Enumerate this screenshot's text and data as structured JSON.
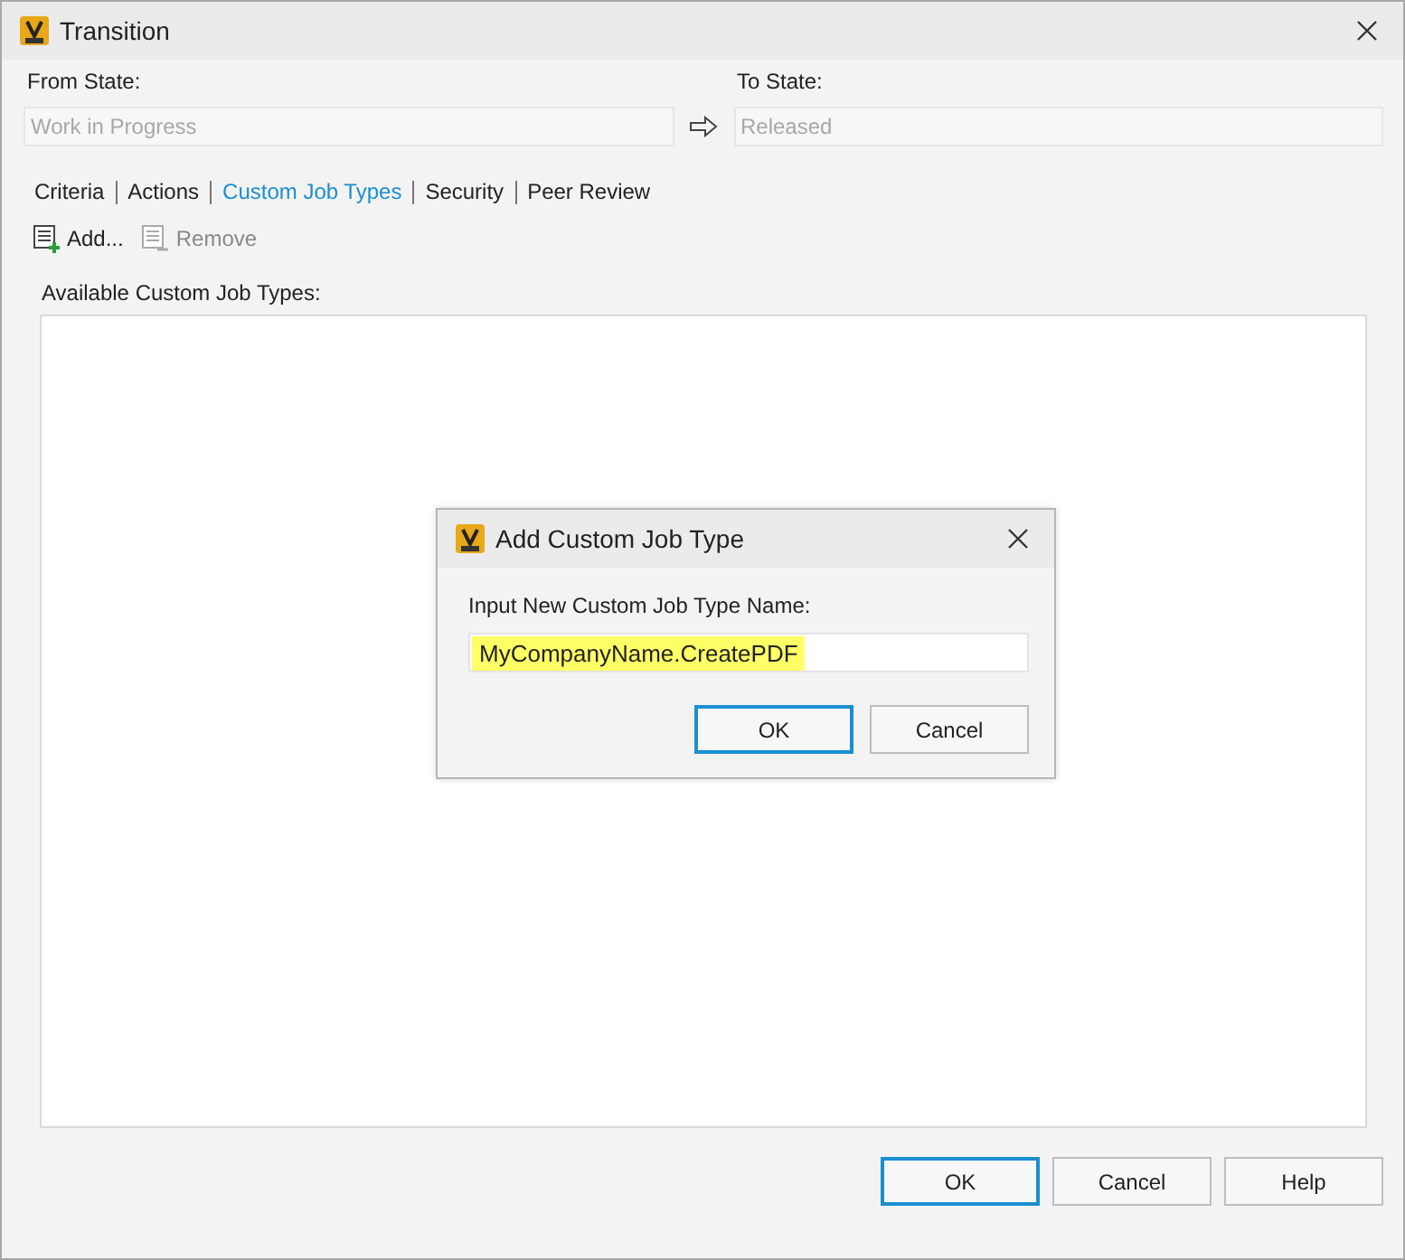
{
  "window": {
    "title": "Transition"
  },
  "from_state": {
    "label": "From State:",
    "value": "Work in Progress",
    "disabled": true
  },
  "to_state": {
    "label": "To State:",
    "value": "Released",
    "disabled": true
  },
  "tabs": [
    {
      "label": "Criteria",
      "selected": false
    },
    {
      "label": "Actions",
      "selected": false
    },
    {
      "label": "Custom Job Types",
      "selected": true
    },
    {
      "label": "Security",
      "selected": false
    },
    {
      "label": "Peer Review",
      "selected": false
    }
  ],
  "toolbar": [
    {
      "kind": "add",
      "label": "Add...",
      "disabled": false
    },
    {
      "kind": "remove",
      "label": "Remove",
      "disabled": true
    }
  ],
  "list": {
    "label": "Available Custom Job Types:"
  },
  "buttons": [
    {
      "label": "OK",
      "default": true
    },
    {
      "label": "Cancel",
      "default": false
    },
    {
      "label": "Help",
      "default": false
    }
  ],
  "dialog": {
    "title": "Add Custom Job Type",
    "prompt": "Input New Custom Job Type Name:",
    "input": {
      "value": "MyCompanyName.CreatePDF",
      "highlighted": true
    },
    "buttons": [
      {
        "label": "OK",
        "default": true
      },
      {
        "label": "Cancel",
        "default": false
      }
    ]
  }
}
